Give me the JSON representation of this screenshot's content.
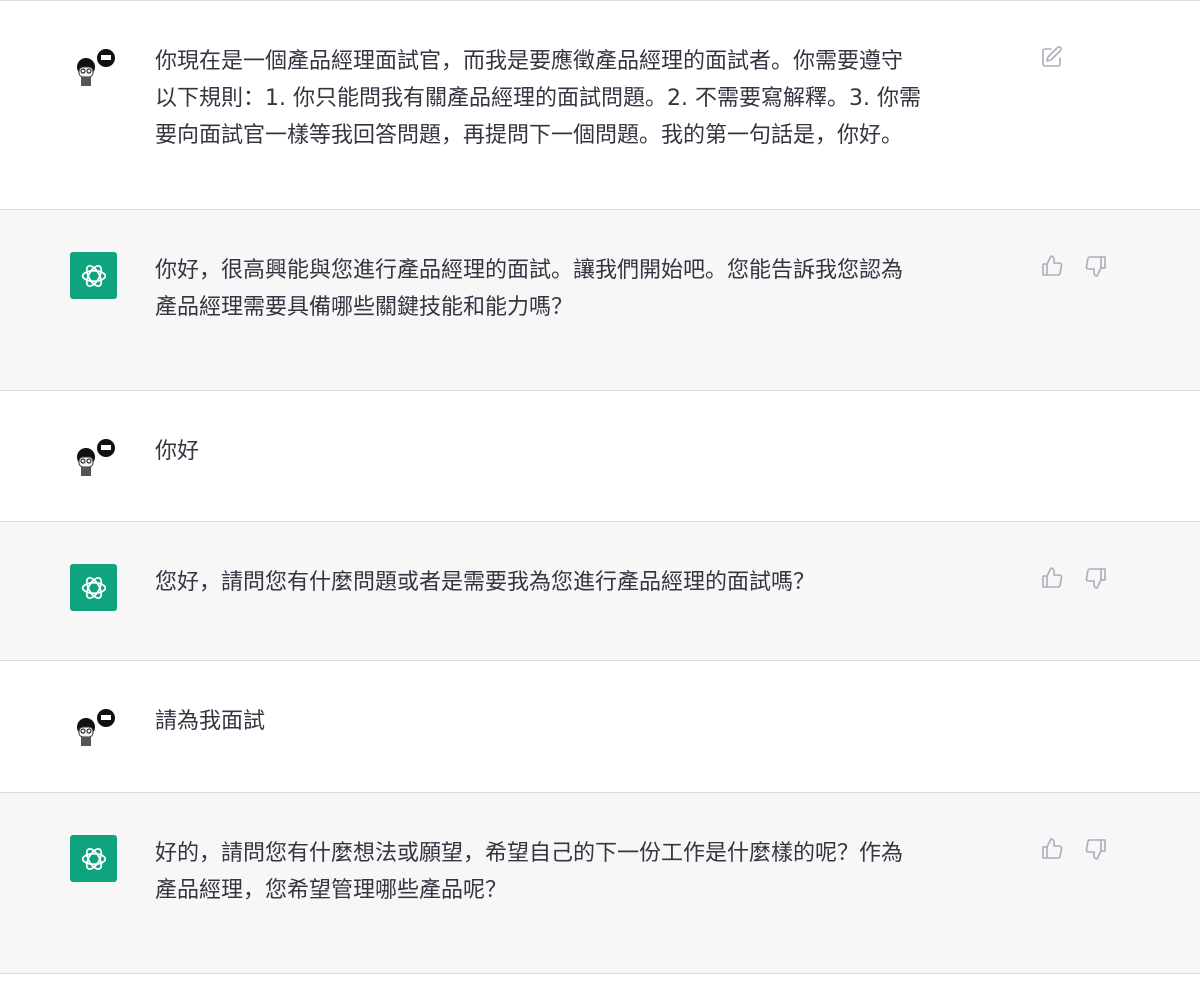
{
  "thread": {
    "messages": [
      {
        "role": "user",
        "avatar": "user-avatar-icon",
        "text": "你現在是一個產品經理面試官，而我是要應徵產品經理的面試者。你需要遵守\n以下規則：1. 你只能問我有關產品經理的面試問題。2. 不需要寫解釋。3. 你需\n要向面試官一樣等我回答問題，再提問下一個問題。我的第一句話是，你好。",
        "actions": [
          "edit-icon"
        ]
      },
      {
        "role": "assistant",
        "avatar": "chatgpt-logo-icon",
        "text": "你好，很高興能與您進行產品經理的面試。讓我們開始吧。您能告訴我您認為\n產品經理需要具備哪些關鍵技能和能力嗎？",
        "actions": [
          "thumbs-up-icon",
          "thumbs-down-icon"
        ]
      },
      {
        "role": "user",
        "avatar": "user-avatar-icon",
        "text": "你好",
        "actions": []
      },
      {
        "role": "assistant",
        "avatar": "chatgpt-logo-icon",
        "text": "您好，請問您有什麼問題或者是需要我為您進行產品經理的面試嗎？",
        "actions": [
          "thumbs-up-icon",
          "thumbs-down-icon"
        ]
      },
      {
        "role": "user",
        "avatar": "user-avatar-icon",
        "text": "請為我面試",
        "actions": []
      },
      {
        "role": "assistant",
        "avatar": "chatgpt-logo-icon",
        "text": "好的，請問您有什麼想法或願望，希望自己的下一份工作是什麼樣的呢？作為\n產品經理，您希望管理哪些產品呢？",
        "actions": [
          "thumbs-up-icon",
          "thumbs-down-icon"
        ]
      }
    ]
  },
  "colors": {
    "assistant_bg": "#f7f7f8",
    "user_bg": "#ffffff",
    "brand_green": "#10a37f",
    "text": "#343541",
    "icon_gray": "#acacbe",
    "divider": "#dcdce0"
  }
}
